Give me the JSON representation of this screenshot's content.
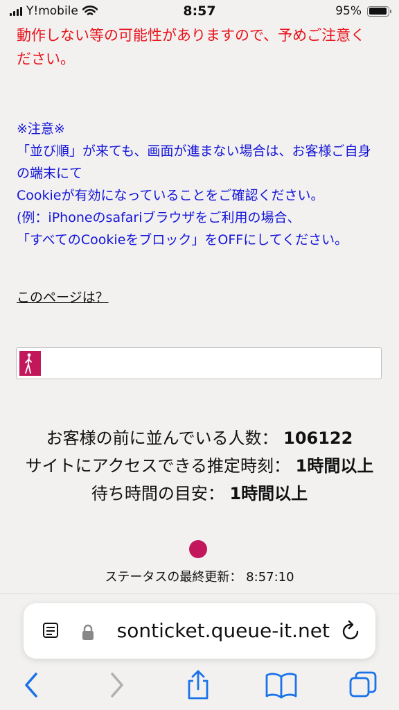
{
  "status_bar": {
    "carrier": "Y!mobile",
    "time": "8:57",
    "battery": "95%"
  },
  "notice": {
    "red_text": "動作しない等の可能性がありますので、予めご注意ください。",
    "blue_lines": [
      "※注意※",
      "「並び順」が来ても、画面が進まない場合は、お客様ご自身の端末にて",
      "Cookieが有効になっていることをご確認ください。",
      "(例：iPhoneのsafariブラウザをご利用の場合、",
      "「すべてのCookieをブロック」をOFFにしてください。"
    ],
    "page_link": "このページは？"
  },
  "queue": {
    "progress_fraction": 0.06,
    "ahead_label": "お客様の前に並んでいる人数：",
    "ahead_value": "106122",
    "eta_label": "サイトにアクセスできる推定時刻：",
    "eta_value": "1時間以上",
    "wait_label": "待ち時間の目安：",
    "wait_value": "1時間以上",
    "updated_label": "ステータスの最終更新：",
    "updated_value": "8:57:10",
    "accent_color": "#c2185b"
  },
  "browser": {
    "url": "sonticket.queue-it.net",
    "icons": [
      "reader-icon",
      "lock-icon",
      "reload-icon",
      "back-icon",
      "forward-icon",
      "share-icon",
      "bookmarks-icon",
      "tabs-icon"
    ]
  }
}
